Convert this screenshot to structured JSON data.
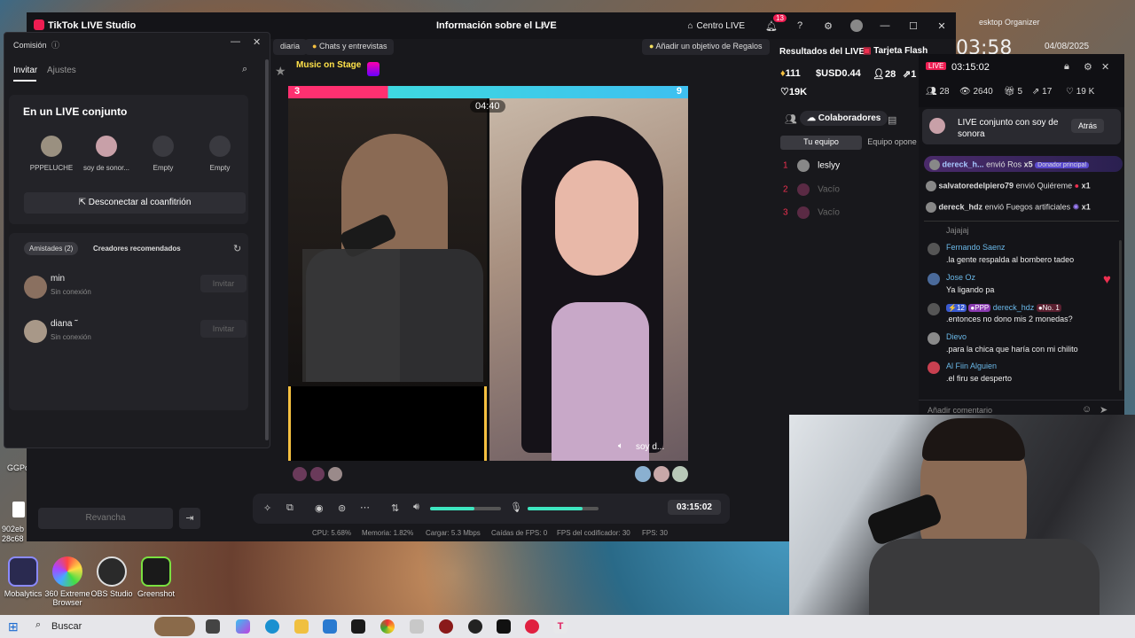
{
  "desktop": {
    "corner_label": "esktop Organizer",
    "clock": "03:58",
    "date": "04/08/2025",
    "icons": [
      {
        "label": "Mobalytics"
      },
      {
        "label": "360 Extreme Browser"
      },
      {
        "label": "OBS Studio"
      },
      {
        "label": "Greenshot"
      }
    ],
    "left_snippets": [
      "GGPo",
      "902eb",
      "28c68"
    ]
  },
  "studio": {
    "app_title": "TikTok LIVE Studio",
    "center_title": "Información sobre el LIVE",
    "centro_live": "Centro LIVE",
    "notification_count": "13",
    "chips": [
      "diaria",
      "Chats y entrevistas"
    ],
    "gift_goal": "Añadir un objetivo de Regalos",
    "music_on_stage": "Music on Stage",
    "battle": {
      "left_score": "3",
      "right_score": "9",
      "timer": "04:40",
      "guest_label": "soy d..."
    },
    "controls": {
      "time": "03:15:02",
      "volume_pct": 62,
      "mic_pct": 78
    },
    "stats": {
      "cpu": "CPU: 5.68%",
      "memory": "Memoria: 1.82%",
      "upload": "Cargar: 5.3 Mbps",
      "fps_drops": "Caídas de FPS: 0",
      "encoder_fps": "FPS del codificador: 30",
      "fps": "FPS: 30"
    },
    "revanche_label": "Revancha"
  },
  "results": {
    "title": "Resultados del LIVE",
    "flash_card": "Tarjeta Flash",
    "stats": [
      {
        "value": "111"
      },
      {
        "value": "USD0.44"
      },
      {
        "value": "28"
      },
      {
        "value": "1"
      }
    ],
    "likes": "19K",
    "collaborators": "Colaboradores",
    "tab_mine": "Tu equipo",
    "tab_opponent": "Equipo opone",
    "team": [
      {
        "rank": "1",
        "name": "leslyy"
      },
      {
        "rank": "2",
        "name": "Vacío"
      },
      {
        "rank": "3",
        "name": "Vacío"
      }
    ]
  },
  "comision": {
    "title": "Comisión",
    "tab_invite": "Invitar",
    "tab_settings": "Ajustes",
    "joint_title": "En un LIVE conjunto",
    "slots": [
      "PPPELUCHE",
      "soy de sonor...",
      "Empty",
      "Empty"
    ],
    "disconnect": "Desconectar al coanfitrión",
    "friends_tab": "Amistades (2)",
    "recommended_tab": "Creadores recomendados",
    "friends": [
      {
        "name": "min",
        "status": "Sin conexión",
        "action": "Invitar"
      },
      {
        "name": "diana ˜",
        "status": "Sin conexión",
        "action": "Invitar"
      }
    ]
  },
  "chat": {
    "live_badge": "LIVE",
    "timer": "03:15:02",
    "stats": [
      "28",
      "2640",
      "5",
      "17",
      "19 K"
    ],
    "joint_banner": "LIVE conjunto con soy de sonora",
    "back": "Atrás",
    "gifts": [
      {
        "user": "dereck_h...",
        "action": "envió Ros",
        "count": "x5",
        "badge": "Donador principal"
      },
      {
        "user": "salvatoredelpiero79",
        "action": "envió Quiéreme",
        "count": "x1"
      },
      {
        "user": "dereck_hdz",
        "action": "envió Fuegos artificiales",
        "count": "x1"
      }
    ],
    "partial_line": "Jajajaj",
    "comments": [
      {
        "name": "Fernando Saenz",
        "text": ".la gente respalda al bombero tadeo"
      },
      {
        "name": "Jose Oz",
        "text": "Ya ligando pa"
      },
      {
        "name": "dereck_hdz",
        "text": ".entonces no dono mis 2 monedas?",
        "level": "12",
        "fan": "PPP",
        "rank": "No. 1"
      },
      {
        "name": "Dievo",
        "text": ".para la chica que haría con mi chilito"
      },
      {
        "name": "Al Fiin Alguien",
        "text": ".el firu se desperto"
      }
    ],
    "input_placeholder": "Añadir comentario"
  },
  "taskbar": {
    "search": "Buscar"
  }
}
